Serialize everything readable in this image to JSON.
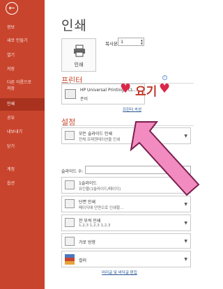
{
  "sidebar": {
    "items": [
      {
        "label": "정보"
      },
      {
        "label": "새로 만들기"
      },
      {
        "label": "열기"
      },
      {
        "label": "저장"
      },
      {
        "label": "다른 이름으로"
      },
      {
        "label": "저장"
      },
      {
        "label": "인쇄"
      },
      {
        "label": "공유"
      },
      {
        "label": "내보내기"
      },
      {
        "label": "닫기"
      },
      {
        "label": "계정"
      },
      {
        "label": "옵션"
      }
    ]
  },
  "main": {
    "title": "인쇄",
    "print_button": "인쇄",
    "copies_label": "복사본:",
    "copies_value": "1",
    "printer_section": "프린터",
    "printer_name": "HP Universal Printing PCL...",
    "printer_status": "준비",
    "printer_props_link": "프린터 속성",
    "settings_section": "설정",
    "setting_slides": {
      "line1": "모든 슬라이드 인쇄",
      "line2": "전체 프레젠테이션을 인쇄"
    },
    "slides_label": "슬라이드 수:",
    "setting_layout": {
      "line1": "1슬라이드",
      "line2": "유인물(1슬라이드/페이지)"
    },
    "setting_sides": {
      "line1": "단면 인쇄",
      "line2": "페이지에 단면으로 인쇄할..."
    },
    "setting_collate": {
      "line1": "한 부씩 인쇄",
      "line2": "1,2,3    1,2,3    1,2,3"
    },
    "setting_orientation": {
      "line1": "가로 방향"
    },
    "setting_color": {
      "line1": "컬러"
    },
    "edit_header_footer_link": "머리글 및 바닥글 편집",
    "info_icon": "i"
  },
  "annotation": {
    "text": "요기",
    "heart": "♥"
  }
}
